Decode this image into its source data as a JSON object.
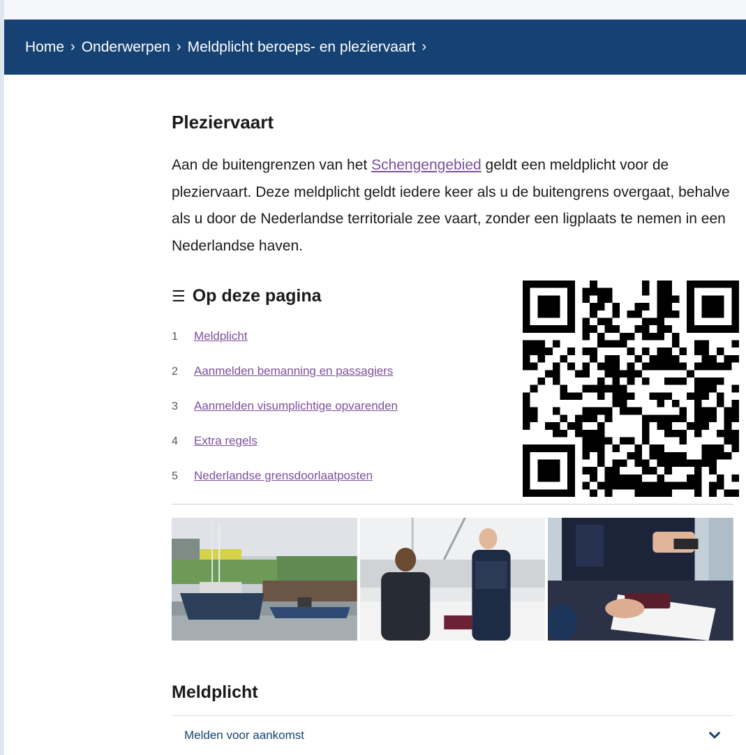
{
  "breadcrumb": {
    "items": [
      "Home",
      "Onderwerpen",
      "Meldplicht beroeps- en pleziervaart"
    ],
    "separator": "›"
  },
  "page": {
    "title": "Pleziervaart",
    "intro_before_link": "Aan de buitengrenzen van het ",
    "intro_link": "Schengengebied",
    "intro_after_link": " geldt een meldplicht voor de pleziervaart. Deze meldplicht geldt iedere keer als u de buitengrens overgaat, behalve als u door de Nederlandse territoriale zee vaart, zonder een ligplaats te nemen in een Nederlandse haven."
  },
  "toc": {
    "heading": "Op deze pagina",
    "icon": "list-icon",
    "items": [
      {
        "num": "1",
        "label": "Meldplicht"
      },
      {
        "num": "2",
        "label": "Aanmelden bemanning en passagiers"
      },
      {
        "num": "3",
        "label": "Aanmelden visumplichtige opvarenden"
      },
      {
        "num": "4",
        "label": "Extra regels"
      },
      {
        "num": "5",
        "label": "Nederlandse grensdoorlaatposten"
      }
    ]
  },
  "photos": [
    "sailboat-harbour-photo",
    "officer-boat-check-photo",
    "passport-clipboard-photo"
  ],
  "section": {
    "title": "Meldplicht",
    "accordion_label": "Melden voor aankomst"
  },
  "colors": {
    "brand": "#154273",
    "link": "#7d4f9c",
    "text": "#1a1a1a"
  }
}
